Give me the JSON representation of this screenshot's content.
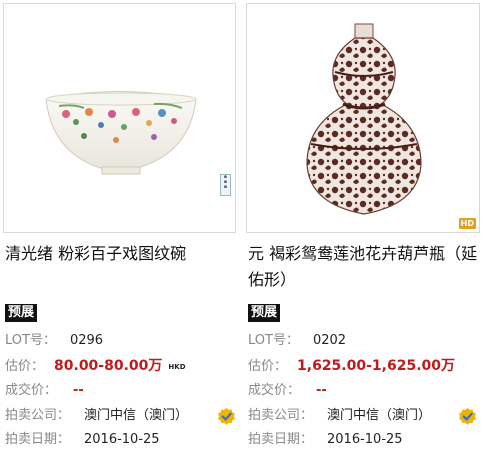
{
  "lots": [
    {
      "title": "清光绪 粉彩百子戏图纹碗",
      "tag": "预展",
      "lot_label": "LOT号：",
      "lot_number": "0296",
      "estimate_label": "估价：",
      "estimate": "80.00-80.00万",
      "currency": "HKD",
      "deal_label": "成交价：",
      "deal_price": "--",
      "company_label": "拍卖公司：",
      "company": "澳门中信（澳门）",
      "date_label": "拍卖日期：",
      "date": "2016-10-25",
      "verified_icon": "verified-badge-icon"
    },
    {
      "title": "元 褐彩鸳鸯莲池花卉葫芦瓶（延佑形）",
      "tag": "预展",
      "lot_label": "LOT号：",
      "lot_number": "0202",
      "estimate_label": "估价：",
      "estimate": "1,625.00-1,625.00万",
      "deal_label": "成交价：",
      "deal_price": "--",
      "company_label": "拍卖公司：",
      "company": "澳门中信（澳门）",
      "date_label": "拍卖日期：",
      "date": "2016-10-25",
      "hd_badge": "HD",
      "verified_icon": "verified-badge-icon"
    }
  ],
  "colors": {
    "price_red": "#c11a1a",
    "badge_gold": "#f0b400",
    "tag_bg": "#111111"
  }
}
